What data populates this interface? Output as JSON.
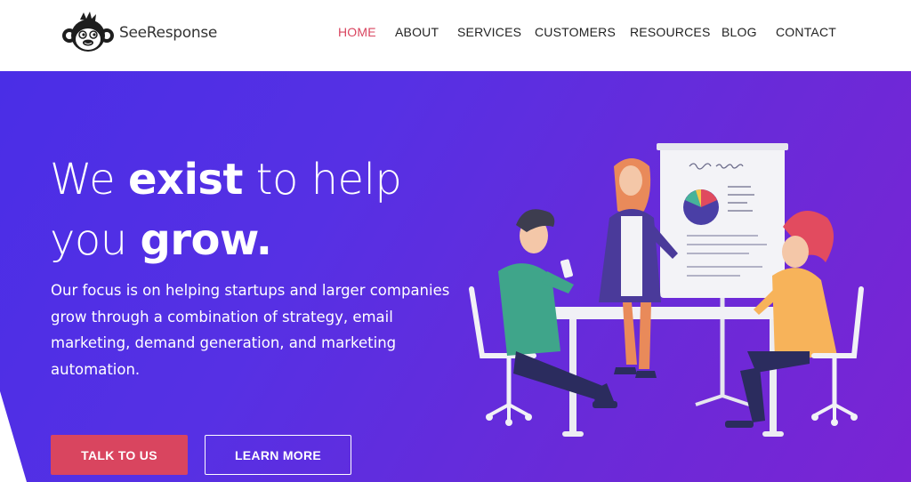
{
  "brand": {
    "name": "SeeResponse",
    "logo_icon": "monkey-head-icon"
  },
  "nav": {
    "items": [
      {
        "label": "HOME",
        "active": true
      },
      {
        "label": "ABOUT",
        "active": false
      },
      {
        "label": "SERVICES",
        "active": false
      },
      {
        "label": "CUSTOMERS",
        "active": false
      },
      {
        "label": "RESOURCES",
        "active": false
      },
      {
        "label": "BLOG",
        "active": false
      },
      {
        "label": "CONTACT",
        "active": false
      }
    ]
  },
  "hero": {
    "headline": {
      "part1": "We ",
      "bold1": "exist",
      "part2": " to help",
      "part3": "you ",
      "bold2": "grow."
    },
    "description": "Our focus is on helping startups and larger companies grow through a combination of strategy, email marketing, demand generation, and marketing automation.",
    "primary_cta": "TALK TO US",
    "secondary_cta": "LEARN MORE",
    "illustration": "team-meeting-illustration"
  },
  "colors": {
    "accent": "#d9455f",
    "hero_gradient_start": "#4a2ee6",
    "hero_gradient_end": "#7a24d4",
    "nav_text": "#222222"
  }
}
